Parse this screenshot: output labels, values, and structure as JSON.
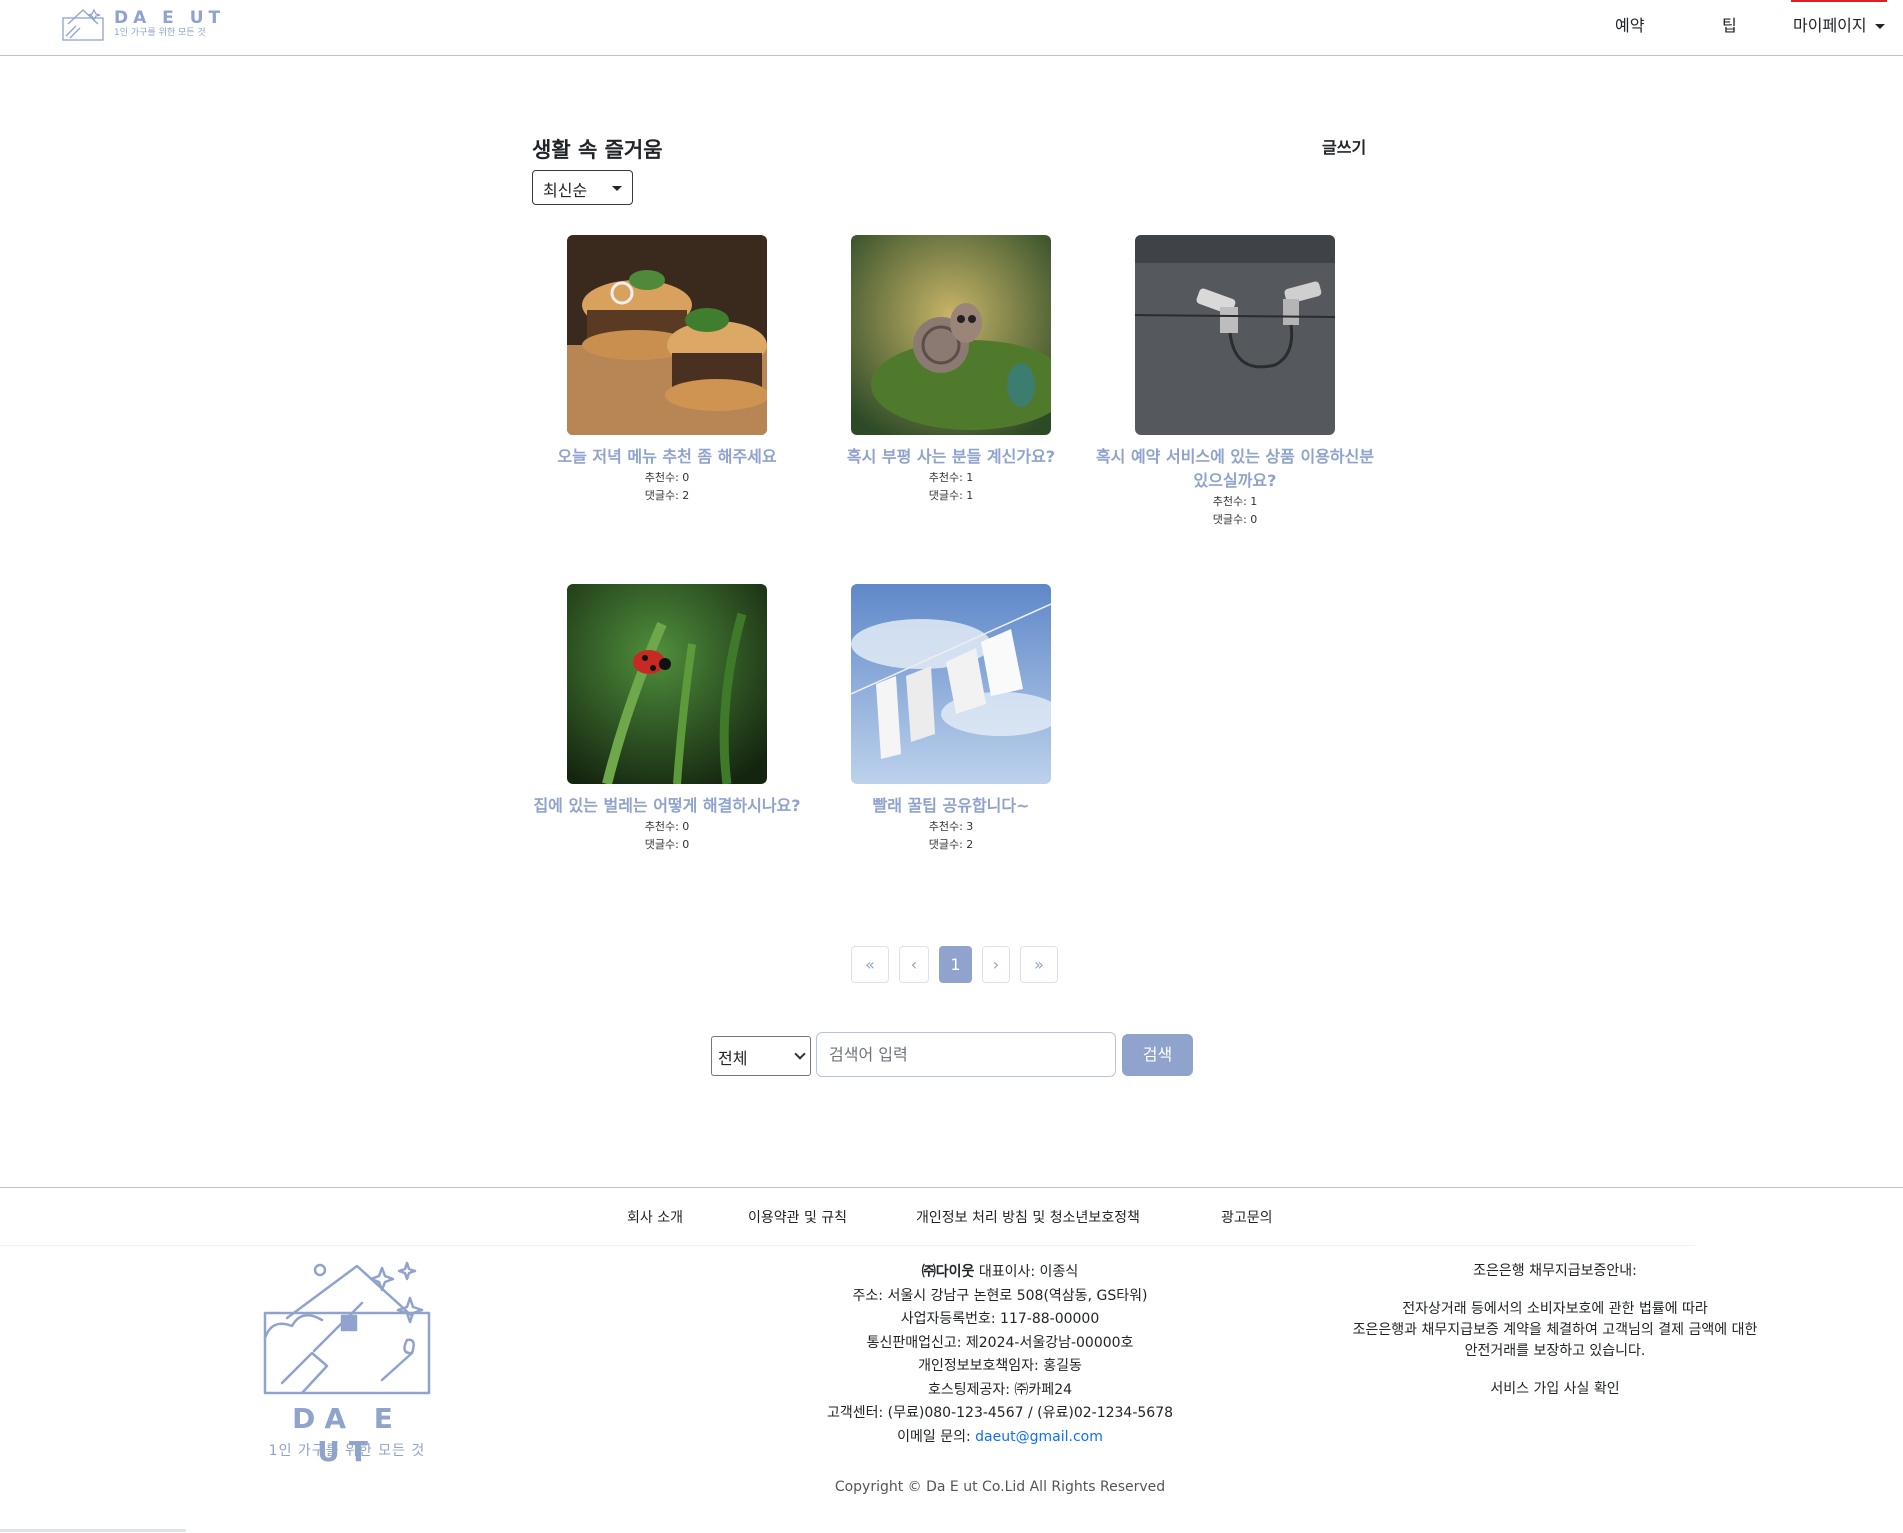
{
  "header": {
    "logo_brand": "DA E UT",
    "logo_tagline": "1인 가구를 위한 모든 것",
    "nav": {
      "reserve": "예약",
      "tips": "팁",
      "mypage": "마이페이지"
    }
  },
  "board": {
    "title": "생활 속 즐거움",
    "write_label": "글쓰기",
    "sort_selected": "최신순"
  },
  "posts": [
    {
      "title": "오늘 저녁 메뉴 추천 좀 해주세요",
      "likes": "추천수: 0",
      "comments": "댓글수: 2",
      "image": "burger-photo"
    },
    {
      "title": "혹시 부평 사는 분들 계신가요?",
      "likes": "추천수: 1",
      "comments": "댓글수: 1",
      "image": "snail-photo"
    },
    {
      "title": "혹시 예약 서비스에 있는 상품 이용하신분 있으실까요?",
      "likes": "추천수: 1",
      "comments": "댓글수: 0",
      "image": "cctv-photo"
    },
    {
      "title": "집에 있는 벌레는 어떻게 해결하시나요?",
      "likes": "추천수: 0",
      "comments": "댓글수: 0",
      "image": "ladybug-photo"
    },
    {
      "title": "빨래 꿀팁 공유합니다~",
      "likes": "추천수: 3",
      "comments": "댓글수: 2",
      "image": "laundry-photo"
    }
  ],
  "pagination": {
    "first": "«",
    "prev": "‹",
    "current": "1",
    "next": "›",
    "last": "»"
  },
  "search": {
    "scope_selected": "전체",
    "placeholder": "검색어 입력",
    "button_label": "검색"
  },
  "footer": {
    "links": [
      "회사 소개",
      "이용약관 및 규칙",
      "개인정보 처리 방침 및 청소년보호정책",
      "광고문의"
    ],
    "logo_brand": "DA E UT",
    "logo_tagline": "1인 가구를 위한 모든 것",
    "company_name": "㈜다이웃",
    "ceo": " 대표이사: 이종식",
    "address": "주소: 서울시 강남구 논현로 508(역삼동, GS타워)",
    "biz_no": "사업자등록번호: 117-88-00000",
    "telecom_no": "통신판매업신고: 제2024-서울강남-00000호",
    "privacy_officer": "개인정보보호책임자: 홍길동",
    "hosting": "호스팅제공자: ㈜카페24",
    "customer_center": "고객센터: (무료)080-123-4567 / (유료)02-1234-5678",
    "email_label": "이메일 문의: ",
    "email": "daeut@gmail.com",
    "bank_title": "조은은행 채무지급보증안내:",
    "bank_line1": "전자상거래 등에서의 소비자보호에 관한 법률에 따라",
    "bank_line2": "조은은행과 채무지급보증 계약을 체결하여 고객님의 결제 금액에 대한",
    "bank_line3": "안전거래를 보장하고 있습니다.",
    "bank_link": "서비스 가입 사실 확인",
    "copyright": "Copyright © Da E ut Co.Lid All Rights Reserved"
  },
  "colors": {
    "accent": "#8fa3cc",
    "link": "#0d6efd"
  }
}
